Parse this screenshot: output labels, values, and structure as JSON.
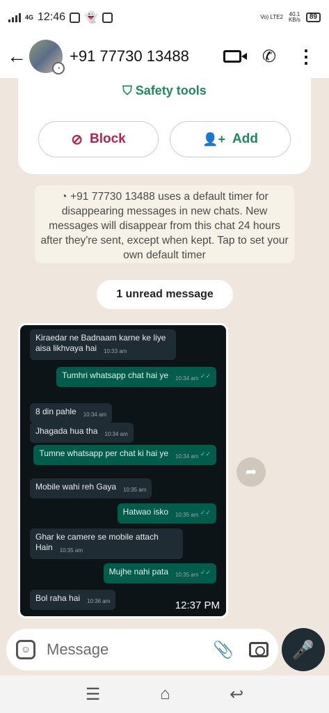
{
  "status_bar": {
    "time": "12:46",
    "network": "4G",
    "volte": "Vo) LTE2",
    "speed_value": "40.1",
    "speed_unit": "KB/s",
    "battery": "89"
  },
  "header": {
    "back_icon": "arrow-left-icon",
    "contact": "+91 77730 13488",
    "icons": [
      "video-call-icon",
      "voice-call-icon",
      "more-options-icon"
    ]
  },
  "card": {
    "safety_label": "Safety tools",
    "block_label": "Block",
    "add_label": "Add"
  },
  "system_message": "+91 77730 13488 uses a default timer for disappearing messages in new chats. New messages will disappear from this chat 24 hours after they're sent, except when kept. Tap to set your own default timer",
  "unread_label": "1 unread message",
  "image_message": {
    "time": "12:37 PM",
    "screenshot_messages": [
      {
        "text": "Kiraedar ne Badnaam karne ke liye aisa likhvaya hai",
        "time": "10:33 am",
        "direction": "in"
      },
      {
        "text": "Tumhri whatsapp chat hai ye",
        "time": "10:34 am",
        "direction": "out"
      },
      {
        "text": "8 din pahle",
        "time": "10:34 am",
        "direction": "in"
      },
      {
        "text": "Jhagada hua tha",
        "time": "10:34 am",
        "direction": "in"
      },
      {
        "text": "Tumne whatsapp per chat ki hai ye",
        "time": "10:34 am",
        "direction": "out"
      },
      {
        "text": "Mobile wahi reh Gaya",
        "time": "10:35 am",
        "direction": "in"
      },
      {
        "text": "Hatwao isko",
        "time": "10:35 am",
        "direction": "out"
      },
      {
        "text": "Ghar ke camere se mobile attach Hain",
        "time": "10:35 am",
        "direction": "in"
      },
      {
        "text": "Mujhe nahi pata",
        "time": "10:35 am",
        "direction": "out"
      },
      {
        "text": "Bol raha hai",
        "time": "10:36 am",
        "direction": "in"
      }
    ]
  },
  "input": {
    "placeholder": "Message"
  },
  "colors": {
    "accent_green": "#1c8b5e",
    "block_red": "#b8224e",
    "outgoing_bubble": "#005c4b",
    "incoming_bubble": "#202c33"
  }
}
